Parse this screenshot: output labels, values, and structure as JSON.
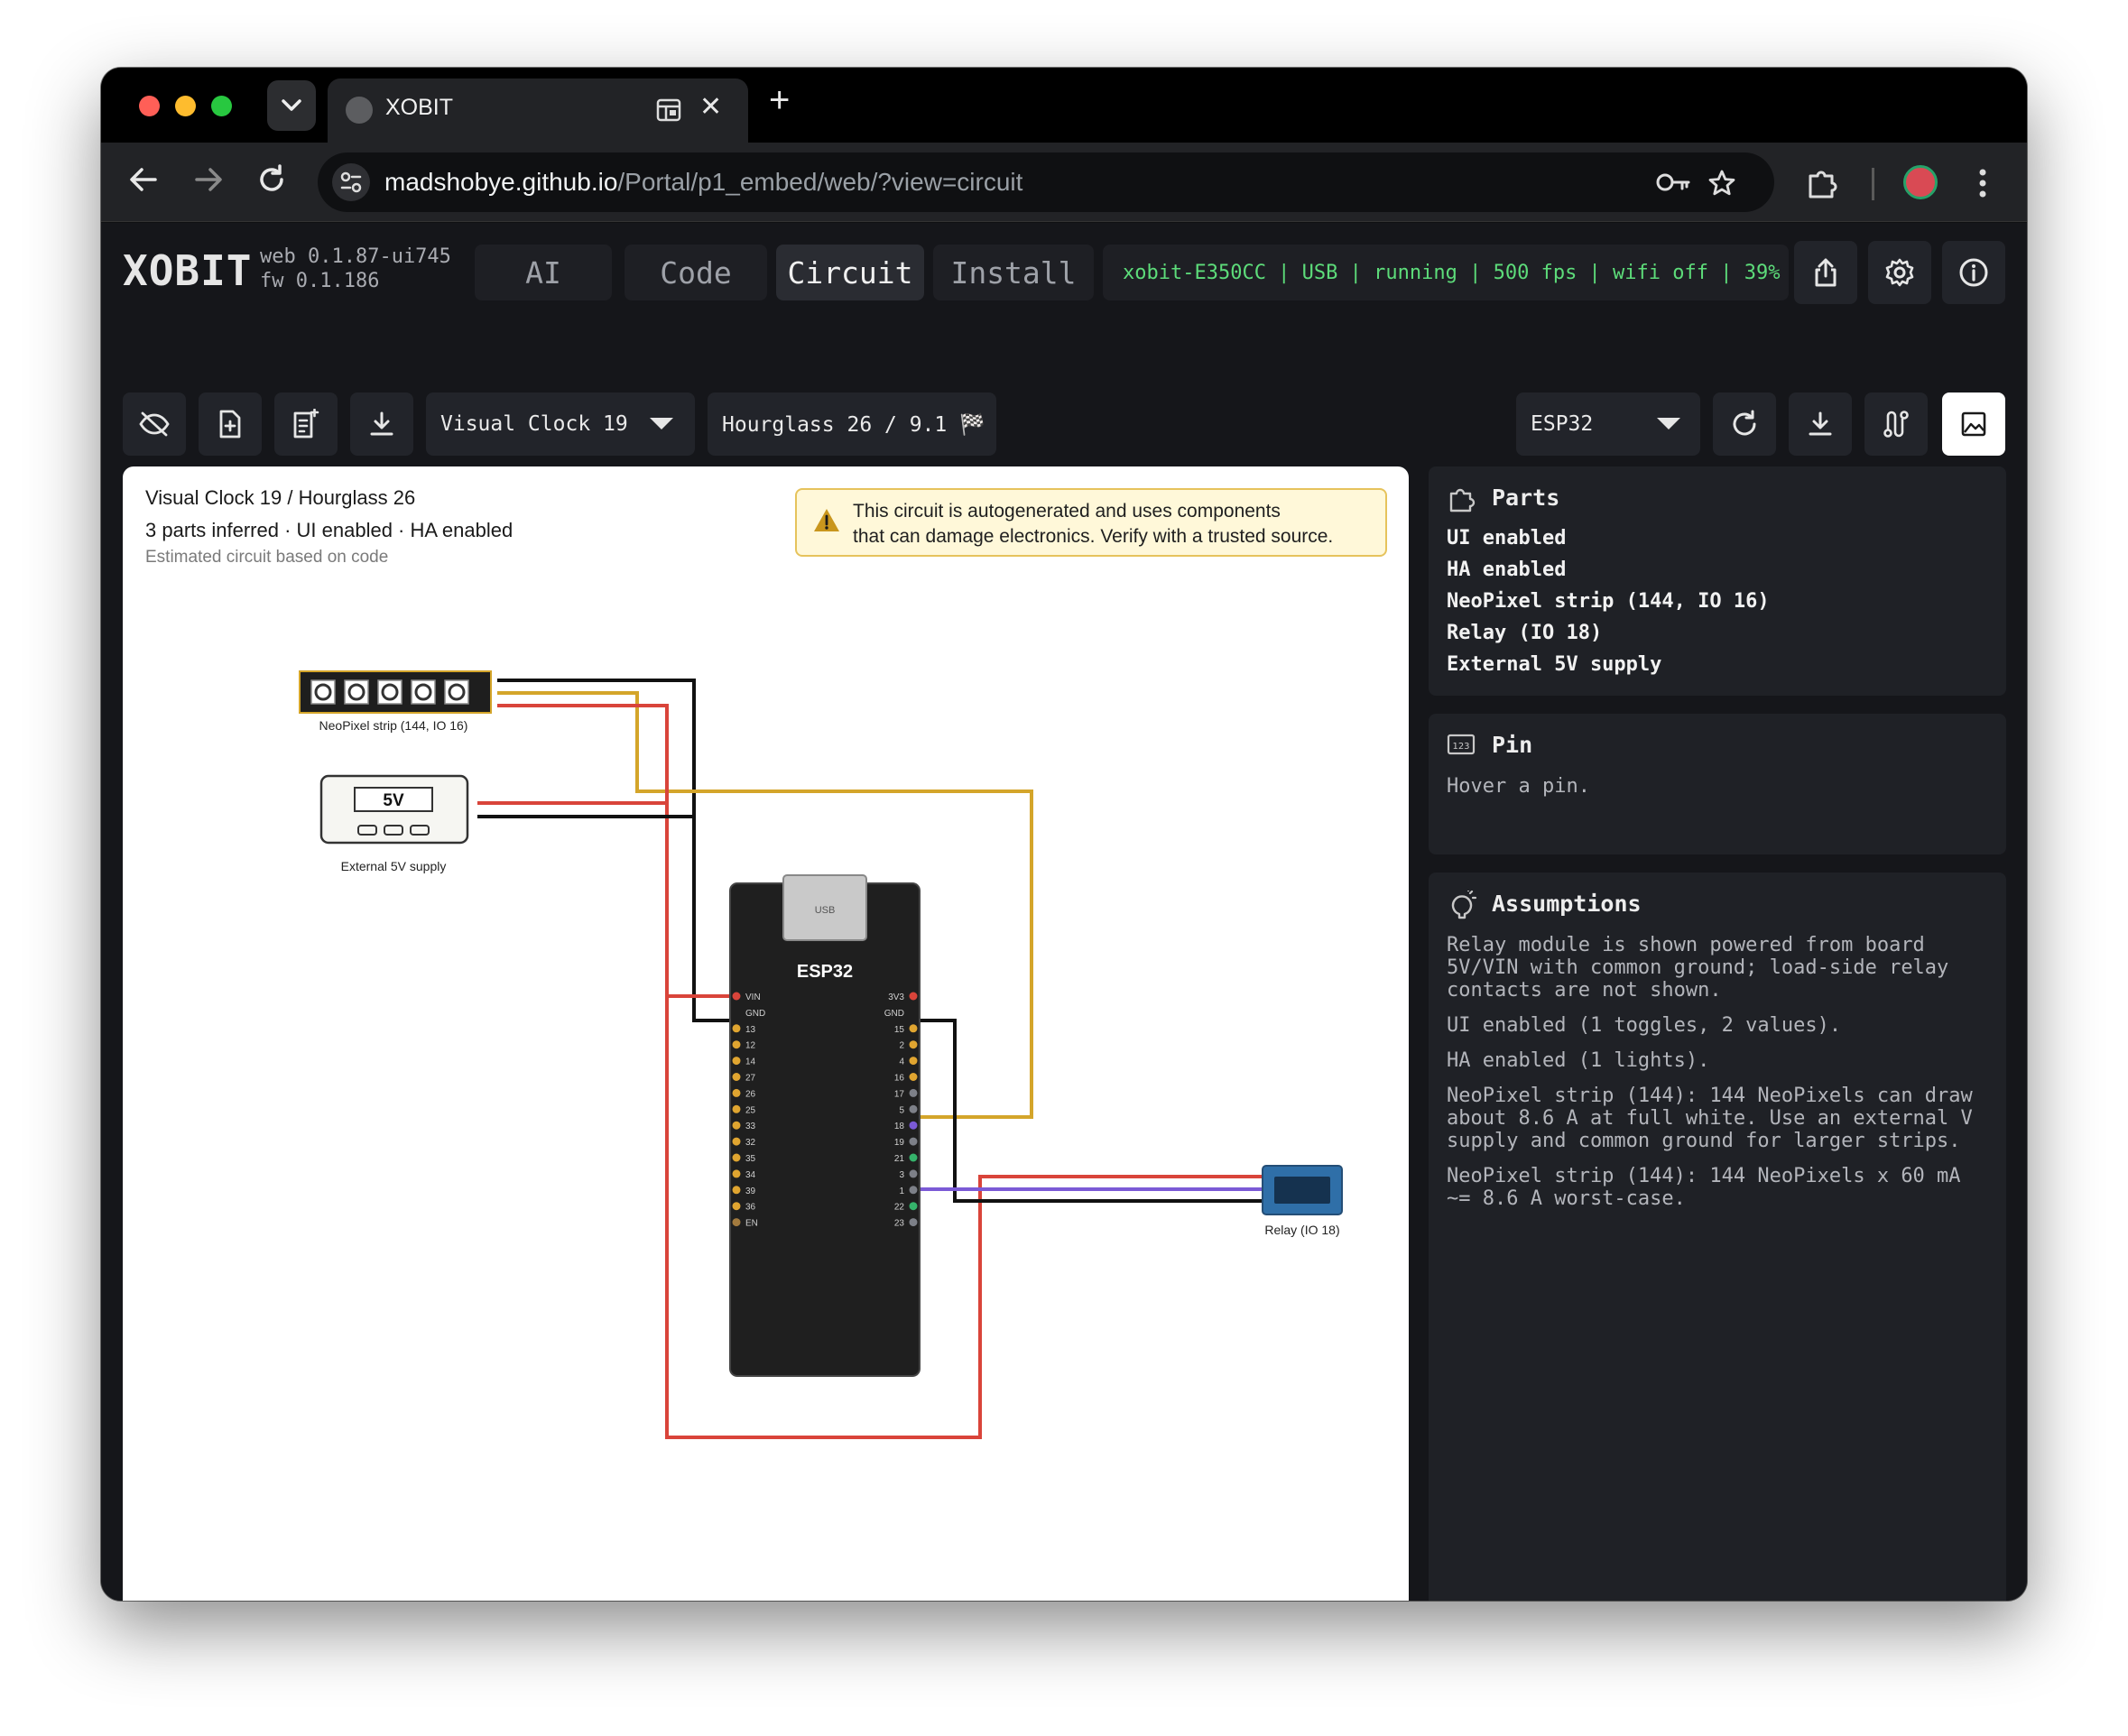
{
  "browser": {
    "tab_title": "XOBIT",
    "url_host": "madshobye.github.io",
    "url_path": "/Portal/p1_embed/web/?view=circuit"
  },
  "app": {
    "logo": "XOBIT",
    "web_version": "web 0.1.87-ui745",
    "fw_version": "fw 0.1.186",
    "tabs": [
      {
        "label": "AI",
        "active": false
      },
      {
        "label": "Code",
        "active": false
      },
      {
        "label": "Circuit",
        "active": true
      },
      {
        "label": "Install",
        "active": false
      }
    ],
    "status": "xobit-E350CC | USB | running | 500 fps | wifi off | 39%"
  },
  "toolbar": {
    "project_select": "Visual Clock 19",
    "variant_label": "Hourglass 26 / 9.1 🏁",
    "board_select": "ESP32"
  },
  "canvas": {
    "title": "Visual Clock 19 / Hourglass 26",
    "subtitle": "3 parts inferred · UI enabled · HA enabled",
    "note": "Estimated circuit based on code",
    "warning_line1": "This circuit is autogenerated and uses components",
    "warning_line2": "that can damage electronics. Verify with a trusted source.",
    "neopixel_label": "NeoPixel strip (144, IO 16)",
    "supply_text": "5V",
    "supply_label": "External 5V supply",
    "usb_label": "USB",
    "board_name": "ESP32",
    "relay_label": "Relay (IO 18)",
    "left_pins": [
      "VIN",
      "GND",
      "13",
      "12",
      "14",
      "27",
      "26",
      "25",
      "33",
      "32",
      "35",
      "34",
      "39",
      "36",
      "EN"
    ],
    "right_pins": [
      "3V3",
      "GND",
      "15",
      "2",
      "4",
      "16",
      "17",
      "5",
      "18",
      "19",
      "21",
      "3",
      "1",
      "22",
      "23"
    ]
  },
  "colors": {
    "wire_red": "#d9443a",
    "wire_black": "#111111",
    "wire_yellow": "#d4a52a",
    "wire_purple": "#7b5ad6",
    "status_green": "#5ddc7a",
    "pin_yellow": "#e0a530",
    "pin_gray": "#7d8088",
    "pin_green": "#35b36b",
    "pin_brown": "#a27a3e",
    "relay_blue": "#2f6fa8"
  },
  "panels": {
    "parts": {
      "title": "Parts",
      "items": [
        "UI enabled",
        "HA enabled",
        "NeoPixel strip (144, IO 16)",
        "Relay (IO 18)",
        "External 5V supply"
      ]
    },
    "pin": {
      "title": "Pin",
      "text": "Hover a pin."
    },
    "assumptions": {
      "title": "Assumptions",
      "items": [
        "Relay module is shown powered from board 5V/VIN with common ground; load-side relay contacts are not shown.",
        "UI enabled (1 toggles, 2 values).",
        "HA enabled (1 lights).",
        "NeoPixel strip (144): 144 NeoPixels can draw about 8.6 A at full white. Use an external V supply and common ground for larger strips.",
        "NeoPixel strip (144): 144 NeoPixels x 60 mA ~= 8.6 A worst-case."
      ]
    }
  }
}
